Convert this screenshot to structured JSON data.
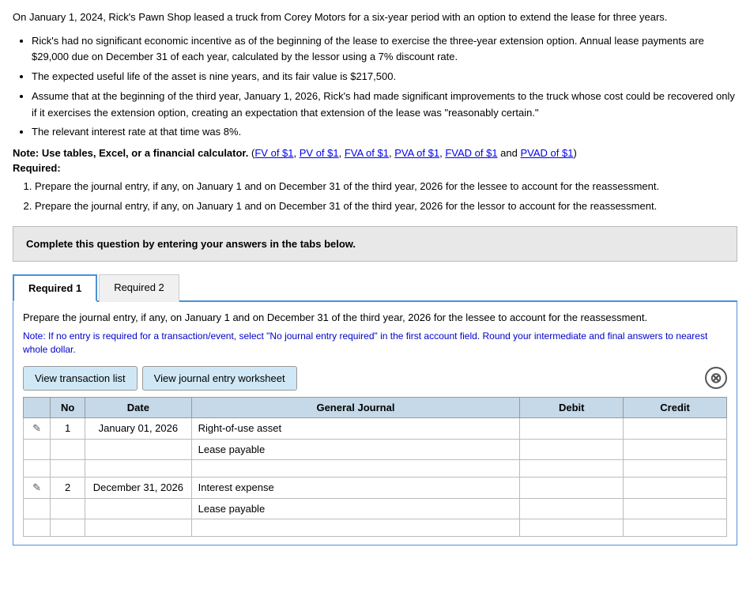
{
  "intro": {
    "paragraph": "On January 1, 2024, Rick's Pawn Shop leased a truck from Corey Motors for a six-year period with an option to extend the lease for three years.",
    "bullets": [
      "Rick's had no significant economic incentive as of the beginning of the lease to exercise the three-year extension option. Annual lease payments are $29,000 due on December 31 of each year, calculated by the lessor using a 7% discount rate.",
      "The expected useful life of the asset is nine years, and its fair value is $217,500.",
      "Assume that at the beginning of the third year, January 1, 2026, Rick's had made significant improvements to the truck whose cost could be recovered only if it exercises the extension option, creating an expectation that extension of the lease was \"reasonably certain.\"",
      "The relevant interest rate at that time was 8%."
    ],
    "note_label": "Note: Use tables, Excel, or a financial calculator.",
    "note_links_prefix": "(",
    "note_links": [
      {
        "label": "FV of $1",
        "href": "#"
      },
      {
        "label": "PV of $1",
        "href": "#"
      },
      {
        "label": "FVA of $1",
        "href": "#"
      },
      {
        "label": "PVA of $1",
        "href": "#"
      },
      {
        "label": "FVAD of $1",
        "href": "#"
      },
      {
        "label": "PVAD of $1",
        "href": "#"
      }
    ],
    "note_links_suffix": ")",
    "required_label": "Required:",
    "numbered_items": [
      "Prepare the journal entry, if any, on January 1 and on December 31 of the third year, 2026 for the lessee to account for the reassessment.",
      "Prepare the journal entry, if any, on January 1 and on December 31 of the third year, 2026 for the lessor to account for the reassessment."
    ]
  },
  "complete_box": {
    "text": "Complete this question by entering your answers in the tabs below."
  },
  "tabs": [
    {
      "label": "Required 1",
      "active": true
    },
    {
      "label": "Required 2",
      "active": false
    }
  ],
  "question_section": {
    "text": "Prepare the journal entry, if any, on January 1 and on December 31 of the third year, 2026 for the lessee to account for the reassessment.",
    "note": "Note: If no entry is required for a transaction/event, select \"No journal entry required\" in the first account field. Round your intermediate and final answers to nearest whole dollar."
  },
  "buttons": {
    "view_transaction": "View transaction list",
    "view_journal": "View journal entry worksheet"
  },
  "table": {
    "headers": [
      "No",
      "Date",
      "General Journal",
      "Debit",
      "Credit"
    ],
    "rows": [
      {
        "no": "1",
        "date": "January 01, 2026",
        "entries": [
          {
            "description": "Right-of-use asset",
            "debit": "",
            "credit": ""
          },
          {
            "description": "Lease payable",
            "debit": "",
            "credit": ""
          }
        ]
      },
      {
        "no": "2",
        "date": "December 31, 2026",
        "entries": [
          {
            "description": "Interest expense",
            "debit": "",
            "credit": ""
          },
          {
            "description": "Lease payable",
            "debit": "",
            "credit": ""
          }
        ]
      }
    ]
  },
  "icons": {
    "pencil": "✎",
    "close": "⊗"
  }
}
